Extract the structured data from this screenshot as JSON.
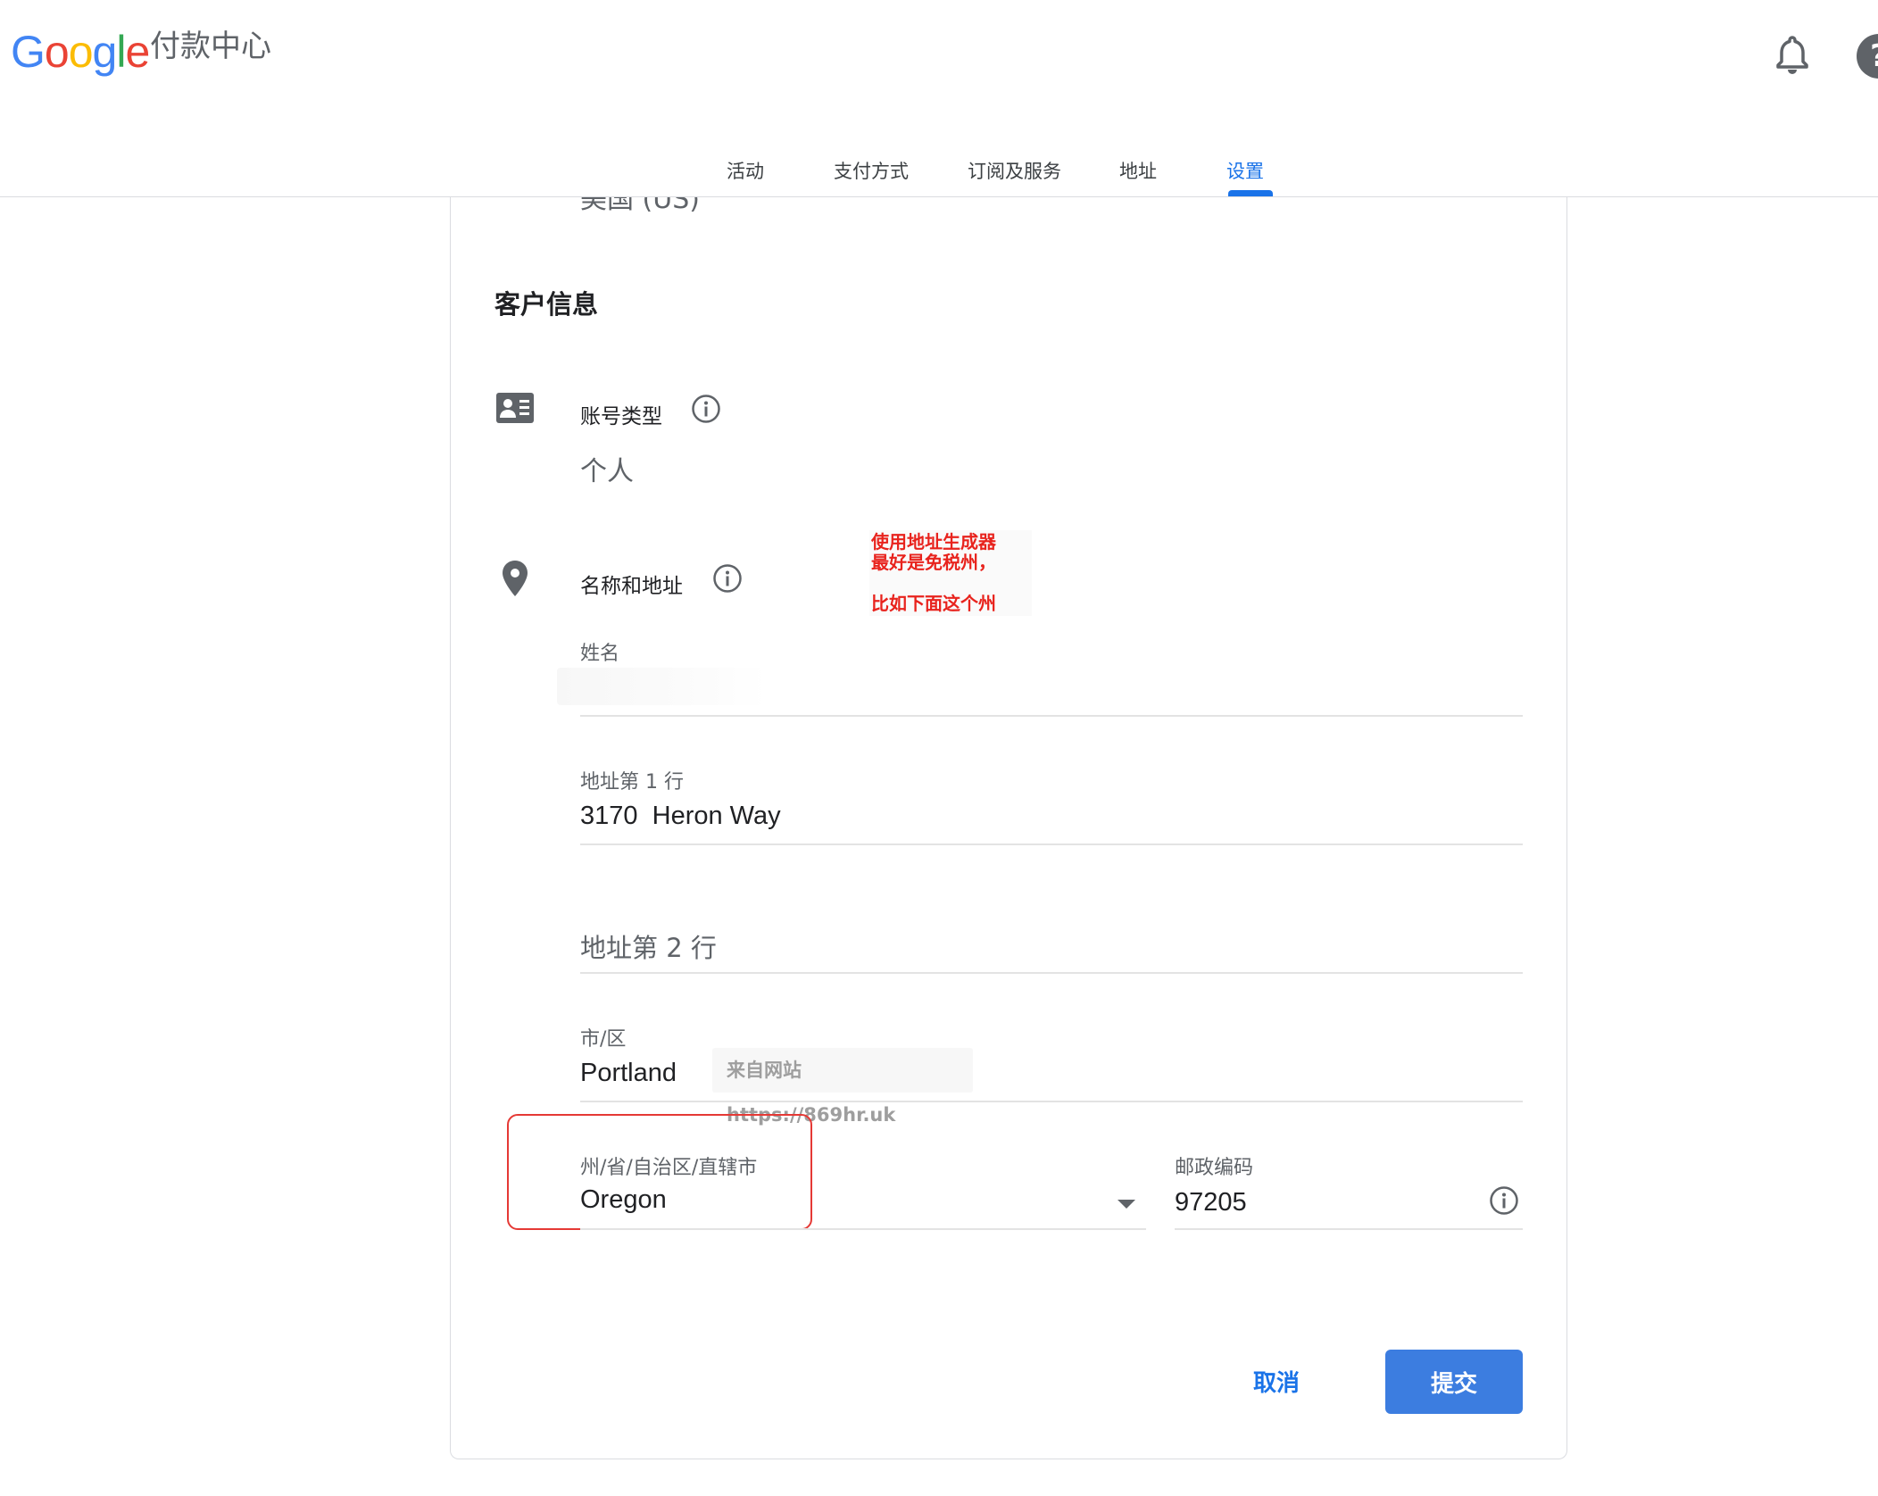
{
  "header": {
    "logo_letters": [
      "G",
      "o",
      "o",
      "g",
      "l",
      "e"
    ],
    "logo_colors": [
      "#4285F4",
      "#EA4335",
      "#FBBC05",
      "#4285F4",
      "#34A853",
      "#EA4335"
    ],
    "product_name": "付款中心",
    "notification_icon": "bell-icon",
    "help_icon": "help-icon",
    "help_glyph": "?"
  },
  "tabs": [
    {
      "label": "活动",
      "active": false
    },
    {
      "label": "支付方式",
      "active": false
    },
    {
      "label": "订阅及服务",
      "active": false
    },
    {
      "label": "地址",
      "active": false
    },
    {
      "label": "设置",
      "active": true
    }
  ],
  "form": {
    "country_value": "美国 (US)",
    "section_title": "客户信息",
    "account_type": {
      "label": "账号类型",
      "value": "个人",
      "icon": "contact-card-icon"
    },
    "name_address": {
      "label": "名称和地址",
      "icon": "location-pin-icon"
    },
    "fields": {
      "name": {
        "label": "姓名",
        "value": ""
      },
      "address_line1": {
        "label": "地址第 1 行",
        "value": "3170  Heron Way"
      },
      "address_line2": {
        "placeholder": "地址第 2 行",
        "value": ""
      },
      "city": {
        "label": "市/区",
        "value": "Portland"
      },
      "state": {
        "label": "州/省/自治区/直辖市",
        "value": "Oregon"
      },
      "postal_code": {
        "label": "邮政编码",
        "value": "97205"
      }
    },
    "buttons": {
      "cancel": "取消",
      "submit": "提交"
    }
  },
  "annotation": {
    "lines": [
      "使用地址生成器",
      "最好是免税州，",
      "",
      "比如下面这个州"
    ],
    "color": "#e8231d"
  },
  "watermark": "来自网站 https://869hr.uk",
  "colors": {
    "accent": "#1a73e8",
    "submit_bg": "#3c7de0",
    "highlight_border": "#e53935"
  }
}
